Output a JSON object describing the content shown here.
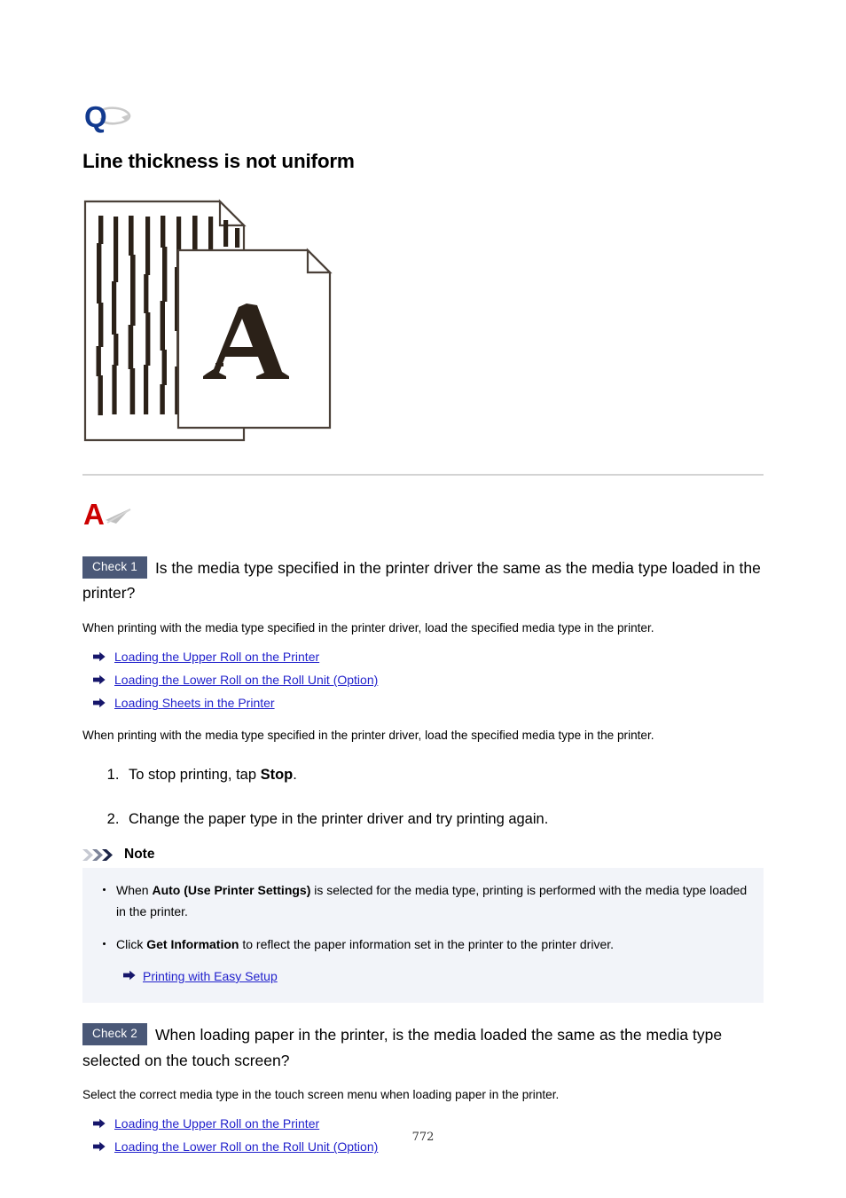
{
  "document": {
    "page_number": "772",
    "question_icon": "question-q-icon",
    "answer_icon": "answer-a-icon",
    "title": "Line thickness is not uniform",
    "illustration": {
      "name": "print-sample-line-thickness-illustration",
      "back_sheet": "striped-test-pattern-sheet",
      "front_sheet": "letter-a-sample-sheet",
      "front_letter": "A"
    }
  },
  "checks": [
    {
      "badge": "Check 1",
      "question": "Is the media type specified in the printer driver the same as the media type loaded in the printer?",
      "intro": "When printing with the media type specified in the printer driver, load the specified media type in the printer.",
      "links": [
        "Loading the Upper Roll on the Printer",
        "Loading the Lower Roll on the Roll Unit (Option)",
        "Loading Sheets in the Printer"
      ],
      "second_paragraph": "When printing with the media type specified in the printer driver, load the specified media type in the printer.",
      "steps": [
        {
          "prefix": "To stop printing, tap ",
          "bold": "Stop",
          "suffix": "."
        },
        {
          "prefix": "Change the paper type in the printer driver and try printing again.",
          "bold": "",
          "suffix": ""
        }
      ]
    },
    {
      "badge": "Check 2",
      "question": "When loading paper in the printer, is the media loaded the same as the media type selected on the touch screen?",
      "intro": "Select the correct media type in the touch screen menu when loading paper in the printer.",
      "links": [
        "Loading the Upper Roll on the Printer",
        "Loading the Lower Roll on the Roll Unit (Option)"
      ]
    }
  ],
  "note": {
    "icon": "triple-chevron-icon",
    "title": "Note",
    "items": [
      {
        "prefix": "When ",
        "bold": "Auto (Use Printer Settings)",
        "suffix": " is selected for the media type, printing is performed with the media type loaded in the printer."
      },
      {
        "prefix": "Click ",
        "bold": "Get Information",
        "suffix": " to reflect the paper information set in the printer to the printer driver."
      }
    ],
    "sublink": "Printing with Easy Setup"
  },
  "colors": {
    "q_blue": "#123a8f",
    "a_red": "#cc0000",
    "badge_bg": "#4a5877",
    "link_blue": "#2222cc",
    "note_bg": "#f2f4f9",
    "rule_gray": "#d3d3d3",
    "ink_dark": "#2b2118"
  }
}
